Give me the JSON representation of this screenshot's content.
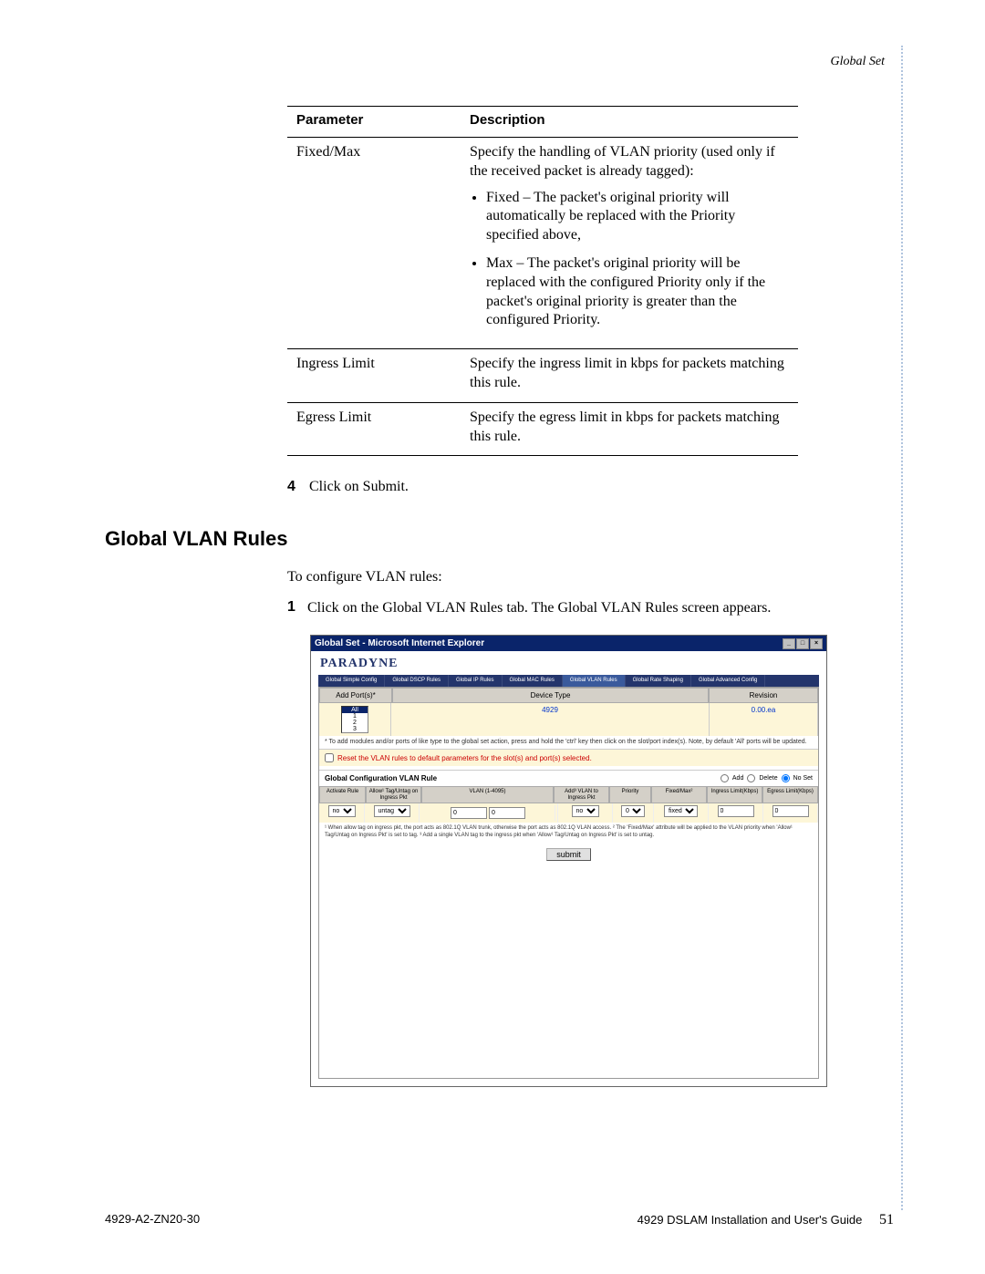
{
  "header": {
    "section": "Global Set"
  },
  "table": {
    "headers": {
      "param": "Parameter",
      "desc": "Description"
    },
    "rows": [
      {
        "param": "Fixed/Max",
        "desc_intro": "Specify the handling of VLAN priority (used only if the received packet is already tagged):",
        "bullets": [
          "Fixed – The packet's original priority will automatically be replaced with the Priority specified above,",
          "Max – The packet's original priority will be replaced with the configured Priority only if the packet's original priority is greater than the configured Priority."
        ]
      },
      {
        "param": "Ingress Limit",
        "desc": "Specify the ingress limit in kbps for packets matching this rule."
      },
      {
        "param": "Egress Limit",
        "desc": "Specify the egress limit in kbps for packets matching this rule."
      }
    ]
  },
  "step4": {
    "num": "4",
    "text": "Click on Submit."
  },
  "section_title": "Global VLAN Rules",
  "intro": "To configure VLAN rules:",
  "step1": {
    "num": "1",
    "text": "Click on the Global VLAN Rules tab. The Global VLAN Rules screen appears."
  },
  "screenshot": {
    "window_title": "Global Set - Microsoft Internet Explorer",
    "brand": "PARADYNE",
    "tabs": [
      "Global\nSimple Config",
      "Global\nDSCP Rules",
      "Global\nIP Rules",
      "Global\nMAC Rules",
      "Global\nVLAN Rules",
      "Global\nRate Shaping",
      "Global\nAdvanced Config"
    ],
    "active_tab_index": 4,
    "table_headers": {
      "a": "Add Port(s)*",
      "b": "Device Type",
      "c": "Revision"
    },
    "ports": [
      "All",
      "1",
      "2",
      "3"
    ],
    "device_type": "4929",
    "revision": "0.00.ea",
    "note": "* To add modules and/or ports of like type to the global set action, press and hold the 'ctrl' key then click on the slot/port index(s). Note, by default 'All' ports will be updated.",
    "reset_text": "Reset the VLAN rules to default parameters for the slot(s) and port(s) selected.",
    "rule_title": "Global Configuration VLAN Rule",
    "radios": [
      "Add",
      "Delete",
      "No Set"
    ],
    "radio_selected": 2,
    "rule_headers": [
      "Activate\nRule",
      "Allow¹\nTag/Untag\non Ingress Pkt",
      "VLAN\n(1-4095)",
      "Add³\nVLAN to\nIngress Pkt",
      "Priority",
      "Fixed/Max²",
      "Ingress\nLimit(Kbps)",
      "Egress\nLimit(Kbps)"
    ],
    "rule_values": {
      "activate": "no",
      "allow": "untag",
      "vlan1": "0",
      "vlan2": "0",
      "addvlan": "no",
      "priority": "0",
      "fixedmax": "fixed",
      "ingress": "0",
      "egress": "0"
    },
    "footnotes": "¹ When allow tag on ingress pkt, the port acts as 802.1Q VLAN trunk, otherwise the port acts as 802.1Q VLAN access.\n² The 'Fixed/Max' attribute will be applied to the VLAN priority when 'Allow¹ Tag/Untag on Ingress Pkt' is set to tag. ³ Add a single VLAN tag to the ingress pkt when 'Allow¹ Tag/Untag on Ingress Pkt' is set to untag.",
    "submit": "submit"
  },
  "footer": {
    "left": "4929-A2-ZN20-30",
    "right": "4929 DSLAM Installation and User's Guide",
    "page": "51"
  }
}
